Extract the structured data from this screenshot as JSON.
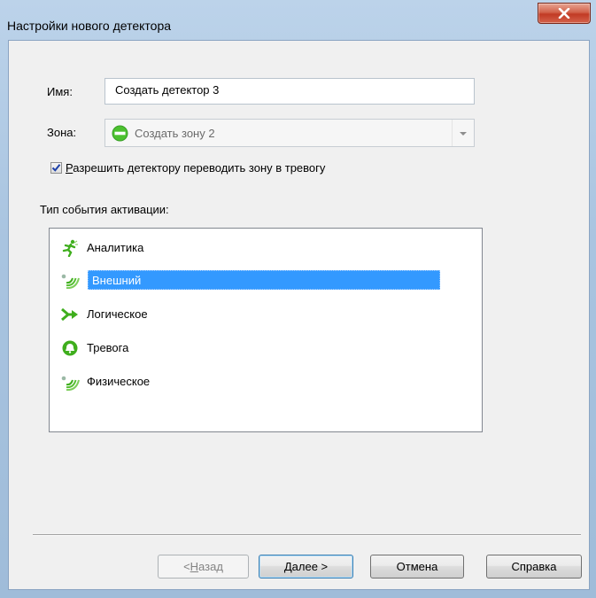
{
  "window": {
    "title": "Настройки нового детектора",
    "close_label": "x"
  },
  "form": {
    "name_label": "Имя:",
    "name_value": "Создать детектор 3",
    "zone_label": "Зона:",
    "zone_value": "Создать зону 2",
    "zone_icon": "no-entry-icon",
    "allow_alarm": {
      "checked": true,
      "label_accel": "Р",
      "label_rest": "азрешить детектору переводить зону в тревогу"
    },
    "event_type_label": "Тип события активации:"
  },
  "event_types": [
    {
      "label": "Аналитика",
      "icon": "running-man-icon",
      "selected": false
    },
    {
      "label": "Внешний",
      "icon": "signal-waves-icon",
      "selected": true
    },
    {
      "label": "Логическое",
      "icon": "merge-arrow-icon",
      "selected": false
    },
    {
      "label": "Тревога",
      "icon": "alarm-bell-icon",
      "selected": false
    },
    {
      "label": "Физическое",
      "icon": "signal-waves-icon",
      "selected": false
    }
  ],
  "buttons": {
    "back_prefix": "< ",
    "back_accel": "Н",
    "back_rest": "азад",
    "next_accel": "Д",
    "next_rest": "алее >",
    "cancel": "Отмена",
    "help": "Справка"
  },
  "colors": {
    "selection": "#3399ff",
    "icon_green": "#3fae1d"
  }
}
